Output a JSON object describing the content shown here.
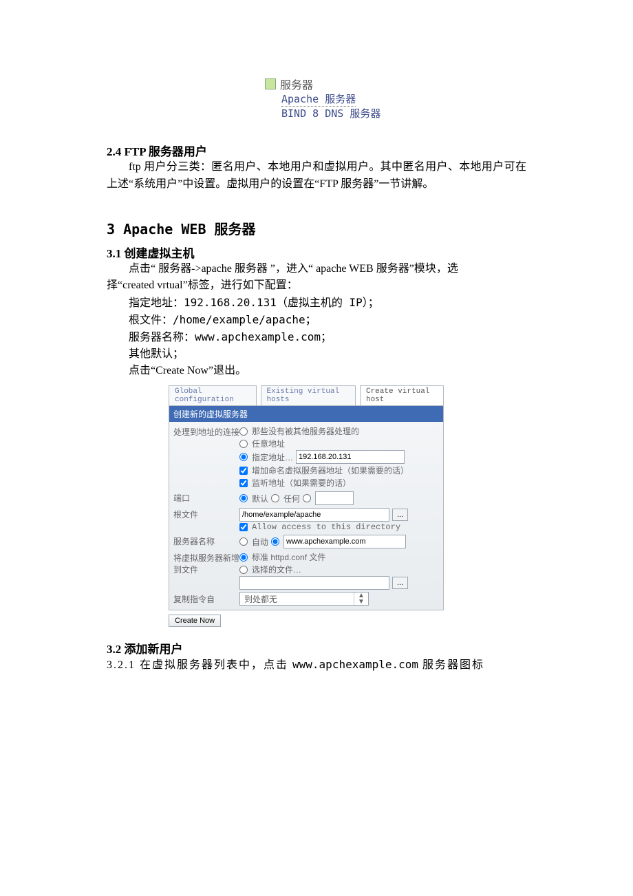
{
  "menu": {
    "title": "服务器",
    "items": [
      "Apache 服务器",
      "BIND 8 DNS 服务器"
    ]
  },
  "sec24": {
    "heading": "2.4 FTP 服务器用户",
    "body": "ftp 用户分三类：匿名用户、本地用户和虚拟用户。其中匿名用户、本地用户可在上述“系统用户”中设置。虚拟用户的设置在“FTP 服务器”一节讲解。"
  },
  "sec3": {
    "heading": "3 Apache WEB 服务器"
  },
  "sec31": {
    "heading": "3.1 创建虚拟主机",
    "intro_l1": "点击“ 服务器->apache 服务器 ”，进入“ apache WEB 服务器”模块，选",
    "intro_l2": "择“created vrtual”标签，进行如下配置：",
    "line_ip": "指定地址：192.168.20.131（虚拟主机的 IP）；",
    "line_root": "根文件：/home/example/apache；",
    "line_name": "服务器名称：www.apchexample.com；",
    "line_other": "其他默认；",
    "line_exit": "点击“Create Now”退出。"
  },
  "form": {
    "tabs": {
      "global": "Global configuration",
      "existing": "Existing virtual hosts",
      "create": "Create virtual host"
    },
    "panel_head": "创建新的虚拟服务器",
    "rows": {
      "handle_label": "处理到地址的连接",
      "handle_opt1": "那些没有被其他服务器处理的",
      "handle_opt2": "任意地址",
      "handle_opt3": "指定地址…",
      "ip_value": "192.168.20.131",
      "chk_addname": "增加命名虚拟服务器地址（如果需要的话）",
      "chk_listen": "监听地址（如果需要的话）",
      "port_label": "端口",
      "port_opt1": "默认",
      "port_opt2": "任何",
      "root_label": "根文件",
      "root_value": "/home/example/apache",
      "root_allow": "Allow access to this directory",
      "server_label": "服务器名称",
      "server_auto": "自动",
      "server_value": "www.apchexample.com",
      "addfile_label": "将虚拟服务器新增到文件",
      "addfile_opt1": "标准 httpd.conf 文件",
      "addfile_opt2": "选择的文件…",
      "copy_label": "复制指令自",
      "copy_value": "到处都无"
    },
    "browse_btn": "...",
    "create_btn": "Create Now"
  },
  "sec32": {
    "heading": "3.2 添加新用户",
    "line1_prefix": "3.2.1 在虚拟服务器列表中，点击 ",
    "line1_host": "www.apchexample.com",
    "line1_suffix": " 服务器图标"
  }
}
